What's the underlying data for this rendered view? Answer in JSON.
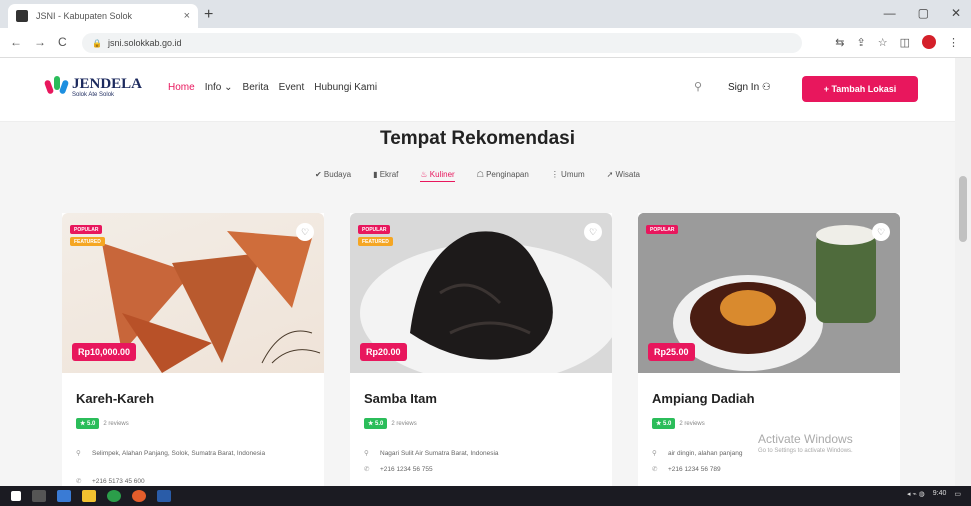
{
  "browser": {
    "tab_title": "JSNI - Kabupaten Solok",
    "tab_close": "×",
    "new_tab": "+",
    "url": "jsni.solokkab.go.id",
    "nav": [
      "←",
      "→",
      "C"
    ],
    "window_controls": [
      "—",
      "▢",
      "✕"
    ]
  },
  "site": {
    "logo_title": "JENDELA",
    "logo_sub": "Solok Ate Solok",
    "nav": [
      {
        "label": "Home",
        "active": true
      },
      {
        "label": "Info ⌄",
        "active": false
      },
      {
        "label": "Berita",
        "active": false
      },
      {
        "label": "Event",
        "active": false
      },
      {
        "label": "Hubungi Kami",
        "active": false
      }
    ],
    "signin": "Sign In",
    "add_button": "+ Tambah Lokasi",
    "accent": "#e8175d"
  },
  "section": {
    "title": "Tempat Rekomendasi",
    "categories": [
      {
        "label": "Budaya",
        "icon": "✔",
        "active": false
      },
      {
        "label": "Ekraf",
        "icon": "▮",
        "active": false
      },
      {
        "label": "Kuliner",
        "icon": "♨",
        "active": true
      },
      {
        "label": "Penginapan",
        "icon": "☖",
        "active": false
      },
      {
        "label": "Umum",
        "icon": "⋮",
        "active": false
      },
      {
        "label": "Wisata",
        "icon": "➚",
        "active": false
      }
    ]
  },
  "cards": [
    {
      "name": "Kareh-Kareh",
      "price": "Rp10,000.00",
      "popular": "POPULAR",
      "featured": "FEATURED",
      "score": "★ 5.0",
      "reviews": "2 reviews",
      "address": "Selimpek, Alahan Panjang, Solok, Sumatra Barat, Indonesia",
      "phone": "+216 5173 45 600"
    },
    {
      "name": "Samba Itam",
      "price": "Rp20.00",
      "popular": "POPULAR",
      "featured": "FEATURED",
      "score": "★ 5.0",
      "reviews": "2 reviews",
      "address": "Nagari Sulit Air Sumatra Barat, Indonesia",
      "phone": "+216 1234 56 755"
    },
    {
      "name": "Ampiang Dadiah",
      "price": "Rp25.00",
      "popular": "POPULAR",
      "score": "★ 5.0",
      "reviews": "2 reviews",
      "address": "air dingin, alahan panjang",
      "phone": "+216 1234 56 789"
    }
  ],
  "watermark": {
    "line1": "Activate Windows",
    "line2": "Go to Settings to activate Windows."
  },
  "taskbar": {
    "time": "9:40"
  }
}
